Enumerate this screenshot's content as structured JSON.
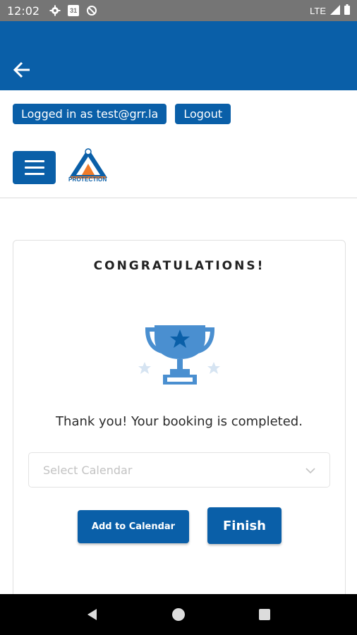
{
  "status_bar": {
    "time": "12:02",
    "calendar_day": "31",
    "network": "LTE",
    "icons": [
      "settings-icon",
      "calendar-icon",
      "data-saver-icon",
      "signal-icon",
      "battery-icon"
    ]
  },
  "app_bar": {
    "back_icon": "arrow-left-icon",
    "color": "#0a5fa8"
  },
  "header": {
    "logged_in_label": "Logged in as test@grr.la",
    "logout_label": "Logout",
    "menu_icon": "hamburger-icon",
    "logo_text": "PROTECTION"
  },
  "card": {
    "title": "CONGRATULATIONS!",
    "trophy_icon": "trophy-icon",
    "message": "Thank you! Your booking is completed.",
    "calendar_select": {
      "placeholder": "Select Calendar",
      "value": ""
    },
    "add_to_calendar_label": "Add to Calendar",
    "finish_label": "Finish"
  },
  "nav_bar": {
    "icons": [
      "back-triangle-icon",
      "home-circle-icon",
      "recents-square-icon"
    ]
  },
  "colors": {
    "primary": "#0a5fa8",
    "trophy": "#4a8fd0",
    "status_bar": "#757575"
  }
}
